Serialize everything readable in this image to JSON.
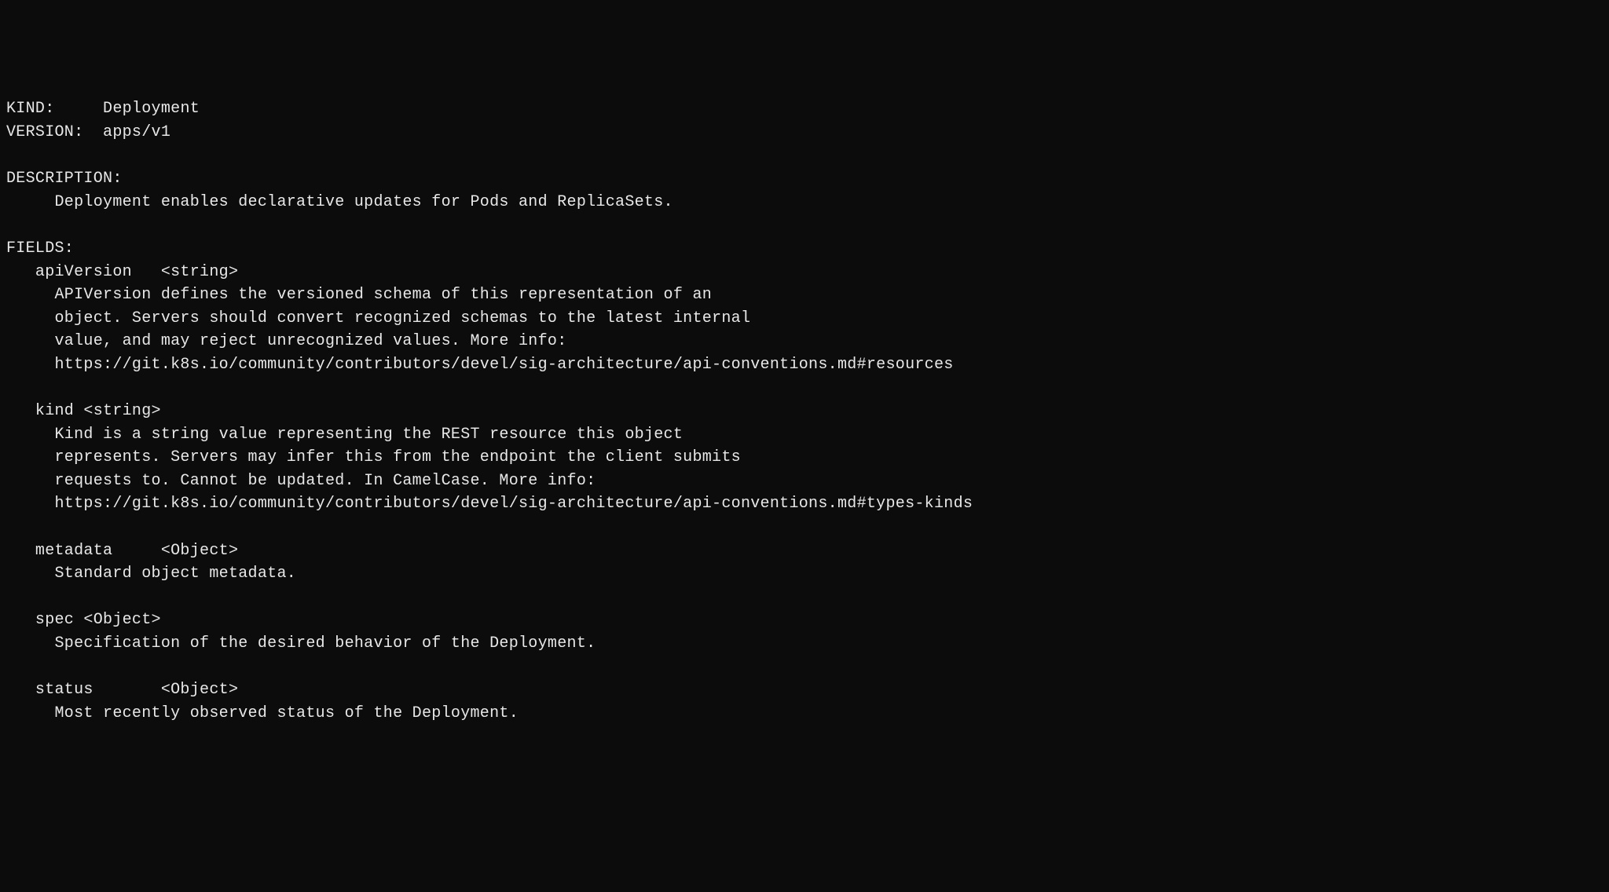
{
  "header": {
    "kind_label": "KIND:     ",
    "kind_value": "Deployment",
    "version_label": "VERSION:  ",
    "version_value": "apps/v1"
  },
  "description": {
    "label": "DESCRIPTION:",
    "text": "     Deployment enables declarative updates for Pods and ReplicaSets."
  },
  "fields": {
    "label": "FIELDS:",
    "items": [
      {
        "name": "   apiVersion   <string>",
        "desc": [
          "     APIVersion defines the versioned schema of this representation of an",
          "     object. Servers should convert recognized schemas to the latest internal",
          "     value, and may reject unrecognized values. More info:",
          "     https://git.k8s.io/community/contributors/devel/sig-architecture/api-conventions.md#resources"
        ]
      },
      {
        "name": "   kind <string>",
        "desc": [
          "     Kind is a string value representing the REST resource this object",
          "     represents. Servers may infer this from the endpoint the client submits",
          "     requests to. Cannot be updated. In CamelCase. More info:",
          "     https://git.k8s.io/community/contributors/devel/sig-architecture/api-conventions.md#types-kinds"
        ]
      },
      {
        "name": "   metadata     <Object>",
        "desc": [
          "     Standard object metadata."
        ]
      },
      {
        "name": "   spec <Object>",
        "desc": [
          "     Specification of the desired behavior of the Deployment."
        ]
      },
      {
        "name": "   status       <Object>",
        "desc": [
          "     Most recently observed status of the Deployment."
        ]
      }
    ]
  }
}
